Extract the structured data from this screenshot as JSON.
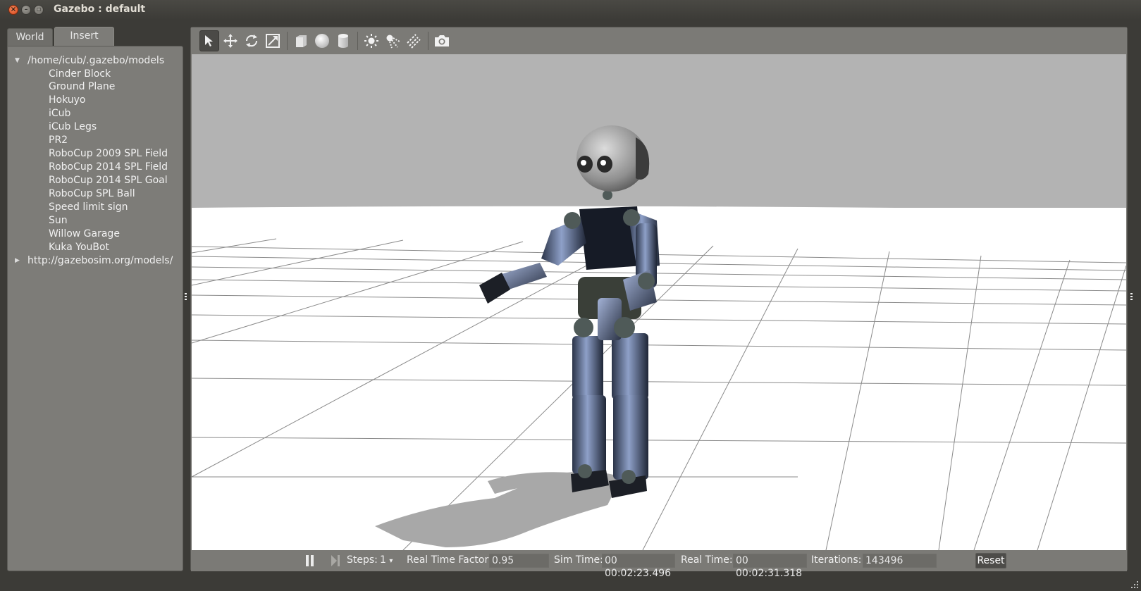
{
  "window": {
    "title": "Gazebo : default"
  },
  "tabs": [
    {
      "label": "World"
    },
    {
      "label": "Insert"
    }
  ],
  "tree": {
    "root": "/home/icub/.gazebo/models",
    "items": [
      "Cinder Block",
      "Ground Plane",
      "Hokuyo",
      "iCub",
      "iCub Legs",
      "PR2",
      "RoboCup 2009 SPL Field",
      "RoboCup 2014 SPL Field",
      "RoboCup 2014 SPL Goal",
      "RoboCup SPL Ball",
      "Speed limit sign",
      "Sun",
      "Willow Garage",
      "Kuka YouBot"
    ],
    "remote": "http://gazebosim.org/models/"
  },
  "toolbar": {
    "icons": [
      "select-arrow-icon",
      "translate-icon",
      "rotate-icon",
      "scale-icon",
      "box-icon",
      "sphere-icon",
      "cylinder-icon",
      "point-light-icon",
      "spot-light-icon",
      "directional-light-icon",
      "screenshot-camera-icon"
    ]
  },
  "bottom": {
    "steps_label": "Steps:",
    "steps_value": "1",
    "rtf_label": "Real Time Factor:",
    "rtf_value": "0.95",
    "sim_time_label": "Sim Time:",
    "sim_time_value": "00 00:02:23.496",
    "real_time_label": "Real Time:",
    "real_time_value": "00 00:02:31.318",
    "iterations_label": "Iterations:",
    "iterations_value": "143496",
    "reset_label": "Reset"
  },
  "colors": {
    "panel": "#7b7a76",
    "titlebar": "#3c3b37",
    "sky": "#b3b3b3",
    "ground": "#ffffff"
  }
}
